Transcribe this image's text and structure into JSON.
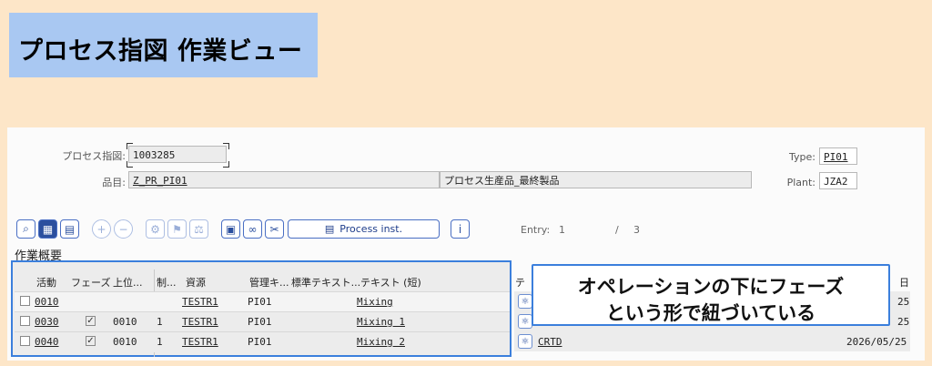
{
  "title": "プロセス指図 作業ビュー",
  "header": {
    "order_label": "プロセス指図:",
    "order_value": "1003285",
    "material_label": "品目:",
    "material_value": "Z_PR_PI01",
    "material_desc": "プロセス生産品_最終製品",
    "type_label": "Type:",
    "type_value": "PI01",
    "plant_label": "Plant:",
    "plant_value": "JZA2"
  },
  "toolbar": {
    "process_inst_label": "Process inst.",
    "entry_label": "Entry:",
    "entry_current": "1",
    "entry_sep": "/",
    "entry_total": "3",
    "icons": [
      "zoom-icon",
      "detail-icon",
      "overview-icon",
      "add-icon",
      "remove-icon",
      "components-icon",
      "flag-icon",
      "balance-icon",
      "document-icon",
      "link-icon",
      "tools-icon",
      "process-inst-icon",
      "info-icon"
    ]
  },
  "section_title": "作業概要",
  "table": {
    "columns": [
      "活動",
      "フェーズ",
      "上位...",
      "制...",
      "資源",
      "管理キ...",
      "標準テキスト...",
      "テキスト (短)"
    ],
    "rows": [
      {
        "activity": "0010",
        "phase": false,
        "parent": "",
        "ctrl": "",
        "resource": "TESTR1",
        "mgmt": "PI01",
        "text": "Mixing"
      },
      {
        "activity": "0030",
        "phase": true,
        "parent": "0010",
        "ctrl": "1",
        "resource": "TESTR1",
        "mgmt": "PI01",
        "text": "Mixing 1"
      },
      {
        "activity": "0040",
        "phase": true,
        "parent": "0010",
        "ctrl": "1",
        "resource": "TESTR1",
        "mgmt": "PI01",
        "text": "Mixing 2"
      }
    ]
  },
  "right_columns": {
    "header_partial_left": "テ",
    "header_partial_right": "日",
    "row1_date": "25",
    "row2_date": "25",
    "row3_status": "CRTD",
    "row3_date": "2026/05/25"
  },
  "callout": {
    "line1": "オペレーションの下にフェーズ",
    "line2": "という形で紐づいている"
  },
  "colors": {
    "background": "#fde6c8",
    "title_box": "#a9c8f2",
    "highlight_border": "#3b7fdc"
  }
}
